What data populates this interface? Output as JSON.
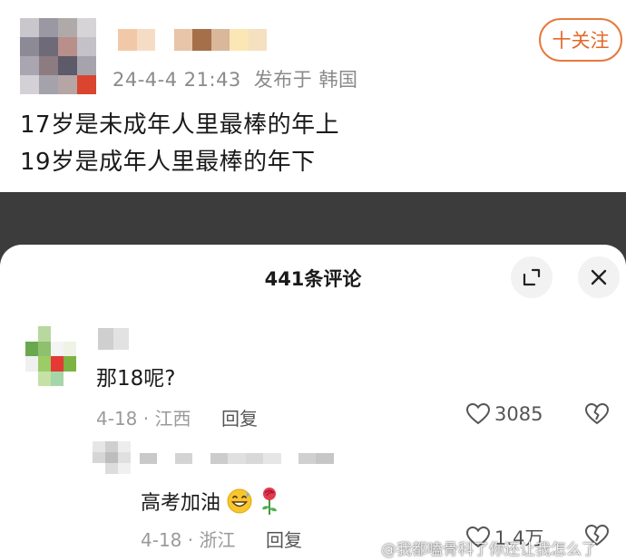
{
  "post": {
    "meta_date": "24-4-4 21:43",
    "meta_location": "发布于 韩国",
    "follow_label": "十关注",
    "lines": [
      "17岁是未成年人里最棒的年上",
      "19岁是成年人里最棒的年下"
    ],
    "avatar_color": "#8e8e94"
  },
  "comments_panel": {
    "title": "441条评论",
    "expand_icon": "expand-icon",
    "close_icon": "close-icon"
  },
  "comments": [
    {
      "text": "那18呢?",
      "date_location": "4-18 · 江西",
      "reply_label": "回复",
      "likes": "3085"
    }
  ],
  "replies": [
    {
      "text": "高考加油",
      "emojis": [
        "grinning-sweat-face-emoji",
        "rose-emoji"
      ],
      "date_location": "4-18 · 浙江",
      "reply_label": "回复",
      "likes": "1.4万"
    }
  ],
  "watermark": "@我都嗑骨科了你还让我怎么了",
  "colors": {
    "accent": "#e2682a",
    "overlay": "#3c3c3c",
    "muted": "#9a9a9a"
  }
}
